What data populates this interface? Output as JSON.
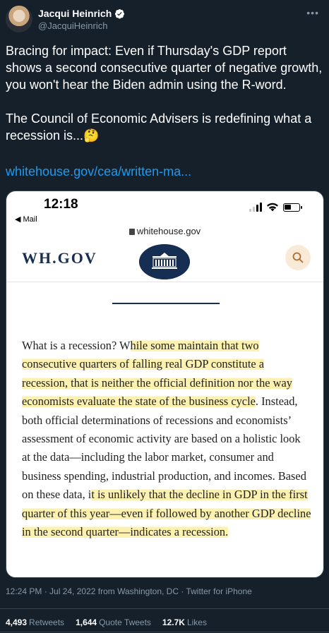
{
  "author": {
    "name": "Jacqui Heinrich",
    "handle": "@JacquiHeinrich",
    "more_label": "•••"
  },
  "tweet": {
    "paragraph1": "Bracing for impact: Even if Thursday's GDP report shows a second consecutive quarter of negative growth, you won't hear the Biden admin using the R-word.",
    "paragraph2": "The Council of Economic Advisers is redefining what a recession is...",
    "emoji": "🤔",
    "link_text": "whitehouse.gov/cea/written-ma..."
  },
  "screenshot": {
    "time": "12:18",
    "back_app": "◀ Mail",
    "url": "whitehouse.gov",
    "site_logo": "WH.GOV",
    "article_segments": [
      {
        "text": "What is a recession? W",
        "highlight": false
      },
      {
        "text": "hile some maintain that two consecutive quarters of falling real GDP constitute a recession, that is neither the official definition nor the way economists evaluate the state of the business cycle",
        "highlight": true
      },
      {
        "text": ". Instead, both official determinations of recessions and economists’ assessment of economic activity are based on a holistic look at the data—including the labor market, consumer and business spending, industrial production, and incomes. Based on these data, i",
        "highlight": false
      },
      {
        "text": "t is unlikely that the decline in GDP in the first quarter of this year—even if followed by another GDP decline in the second quarter—indicates a recession.",
        "highlight": true
      }
    ]
  },
  "meta": {
    "timestamp": "12:24 PM · Jul 24, 2022 from Washington, DC · Twitter for iPhone"
  },
  "stats": {
    "retweets_count": "4,493",
    "retweets_label": "Retweets",
    "quotes_count": "1,644",
    "quotes_label": "Quote Tweets",
    "likes_count": "12.7K",
    "likes_label": "Likes"
  },
  "colors": {
    "background": "#15202b",
    "link": "#1d9bf0",
    "secondary_text": "#8899a6",
    "highlight": "#fdf1b0",
    "wh_navy": "#162e51"
  }
}
